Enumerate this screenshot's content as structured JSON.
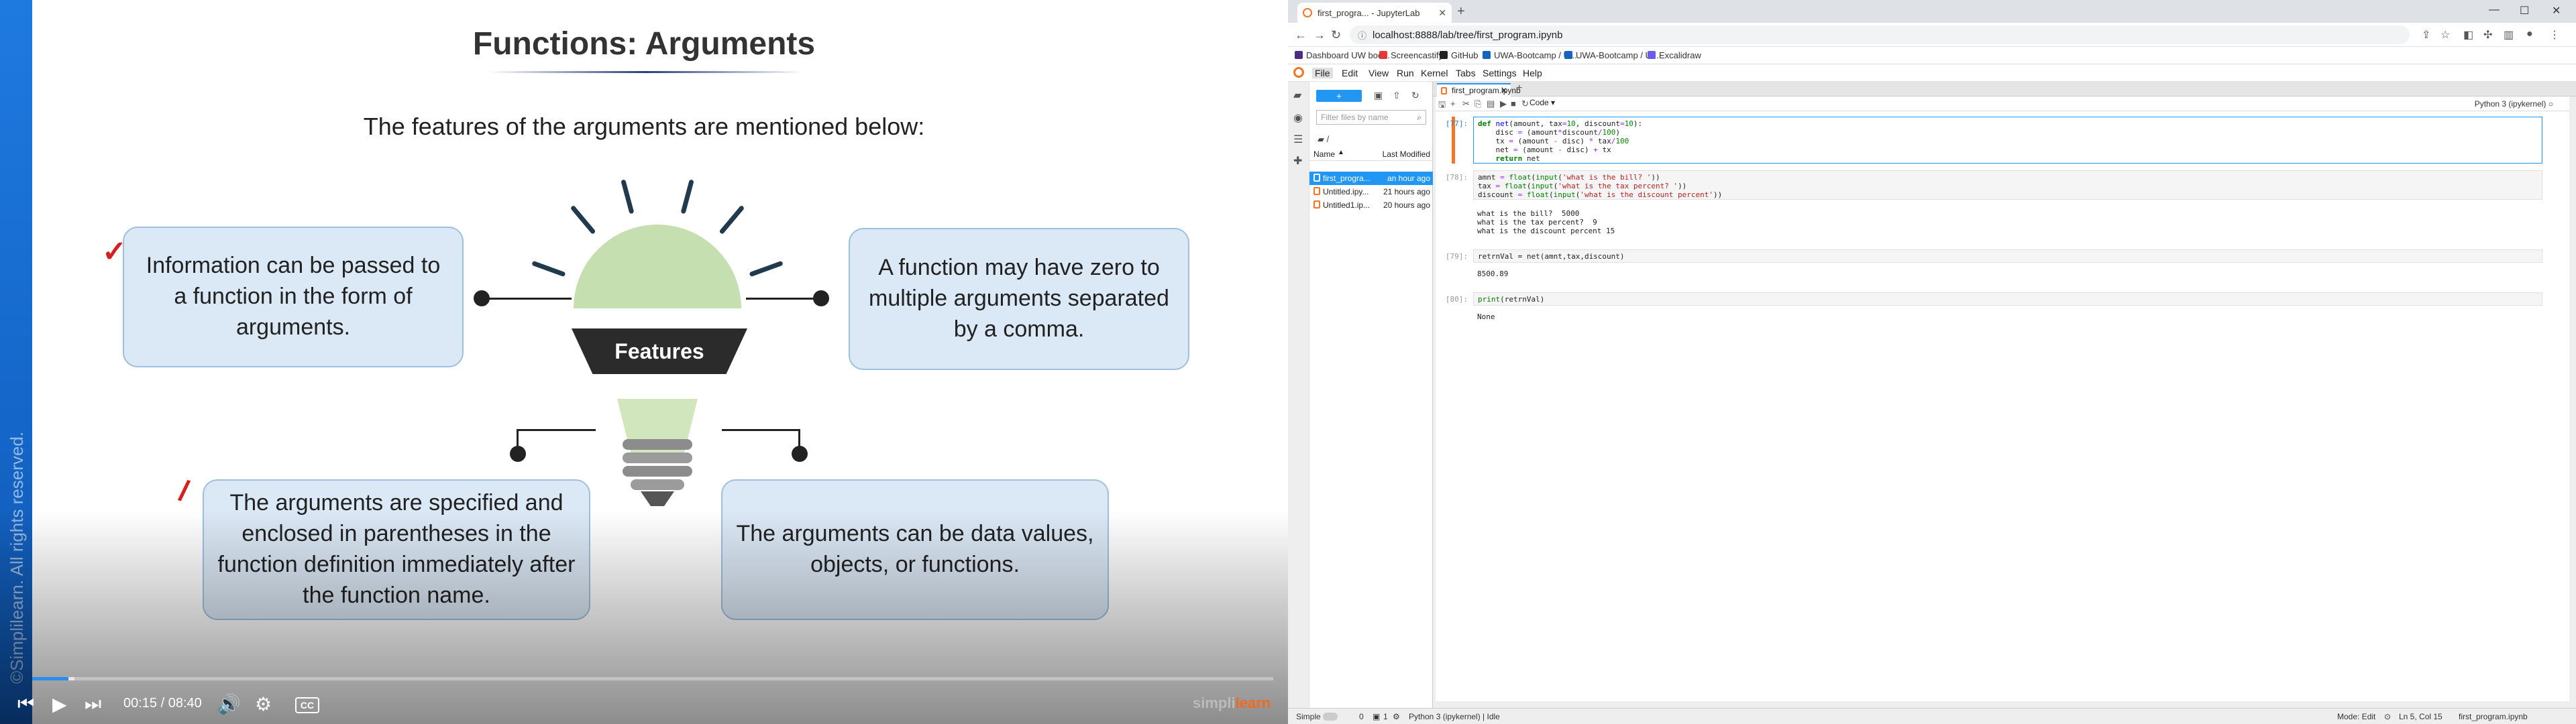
{
  "video": {
    "watermark": "©Simplilearn. All rights reserved.",
    "slide_title": "Functions: Arguments",
    "slide_subtitle": "The features of the arguments are mentioned below:",
    "features_label": "Features",
    "boxes": [
      "Information can be passed to a function in the form of arguments.",
      "A function may have zero to multiple arguments separated by a comma.",
      "The arguments are specified and enclosed in parentheses in the function definition immediately after the function name.",
      "The arguments can be data values, objects, or functions."
    ],
    "annotation_marks": [
      "✓",
      "/"
    ],
    "controls": {
      "time_current": "00:15",
      "time_separator": "/",
      "time_total": "08:40",
      "cc_label": "CC",
      "played_fraction": 0.029,
      "buffered_fraction": 0.034
    },
    "brand": {
      "part1": "simpli",
      "part2": "learn"
    }
  },
  "browser": {
    "tab_title": "first_progra... - JupyterLab",
    "url": "localhost:8888/lab/tree/first_program.ipynb",
    "window_controls": [
      "—",
      "☐",
      "✕"
    ],
    "bookmarks": [
      {
        "label": "Dashboard UW boo...",
        "color": "#4b2e83"
      },
      {
        "label": "Screencastify",
        "color": "#e53935"
      },
      {
        "label": "GitHub",
        "color": "#222222"
      },
      {
        "label": "UWA-Bootcamp / U...",
        "color": "#1565c0"
      },
      {
        "label": "UWA-Bootcamp / U...",
        "color": "#1565c0"
      },
      {
        "label": "Excalidraw",
        "color": "#6c5ce7"
      }
    ]
  },
  "jupyter": {
    "menus": [
      "File",
      "Edit",
      "View",
      "Run",
      "Kernel",
      "Tabs",
      "Settings",
      "Help"
    ],
    "filebrowser": {
      "new_label": "+",
      "search_placeholder": "Filter files by name",
      "breadcrumb": "/",
      "col_name": "Name",
      "col_modified": "Last Modified",
      "files": [
        {
          "name": "first_progra...",
          "modified": "an hour ago",
          "selected": true
        },
        {
          "name": "Untitled.ipy...",
          "modified": "21 hours ago",
          "selected": false
        },
        {
          "name": "Untitled1.ip...",
          "modified": "20 hours ago",
          "selected": false
        }
      ]
    },
    "doc_tab": "first_program.ipynb",
    "cell_type": "Code",
    "kernel_name": "Python 3 (ipykernel)",
    "cells": [
      {
        "prompt": "[77]:",
        "code": "def net(amount, tax=10, discount=10):\n    disc = (amount*discount/100)\n    tx = (amount - disc) * tax/100\n    net = (amount - disc) + tx\n    return net",
        "output": ""
      },
      {
        "prompt": "[78]:",
        "code": "amnt = float(input('what is the bill? '))\ntax = float(input('what is the tax percent? '))\ndiscount = float(input('what is the discount percent'))",
        "output": "what is the bill?  5000\nwhat is the tax percent?  9\nwhat is the discount percent 15"
      },
      {
        "prompt": "[79]:",
        "code": "retrnVal = net(amnt,tax,discount)",
        "output": "8500.89"
      },
      {
        "prompt": "[80]:",
        "code": "print(retrnVal)",
        "output": "None"
      }
    ],
    "status": {
      "mode_label": "Simple",
      "counter_a": "0",
      "counter_b": "1",
      "kernel": "Python 3 (ipykernel) | Idle",
      "edit_mode": "Mode: Edit",
      "cursor": "Ln 5, Col 15",
      "file": "first_program.ipynb"
    }
  }
}
